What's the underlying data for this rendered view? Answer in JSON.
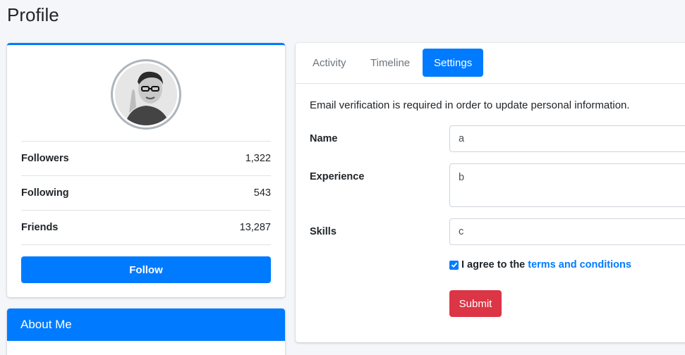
{
  "page": {
    "title": "Profile"
  },
  "profile": {
    "avatar_alt": "user-avatar",
    "stats": [
      {
        "label": "Followers",
        "value": "1,322"
      },
      {
        "label": "Following",
        "value": "543"
      },
      {
        "label": "Friends",
        "value": "13,287"
      }
    ],
    "follow_label": "Follow"
  },
  "about": {
    "title": "About Me"
  },
  "tabs": [
    {
      "label": "Activity",
      "active": false
    },
    {
      "label": "Timeline",
      "active": false
    },
    {
      "label": "Settings",
      "active": true
    }
  ],
  "settings": {
    "notice": "Email verification is required in order to update personal information.",
    "fields": [
      {
        "label": "Name",
        "value": "a"
      },
      {
        "label": "Experience",
        "value": "b"
      },
      {
        "label": "Skills",
        "value": "c"
      }
    ],
    "agree_text": "I agree to the",
    "agree_link": "terms and conditions",
    "agree_checked": true,
    "submit_label": "Submit"
  },
  "colors": {
    "primary": "#007bff",
    "danger": "#dc3545",
    "background": "#f4f6f9"
  }
}
